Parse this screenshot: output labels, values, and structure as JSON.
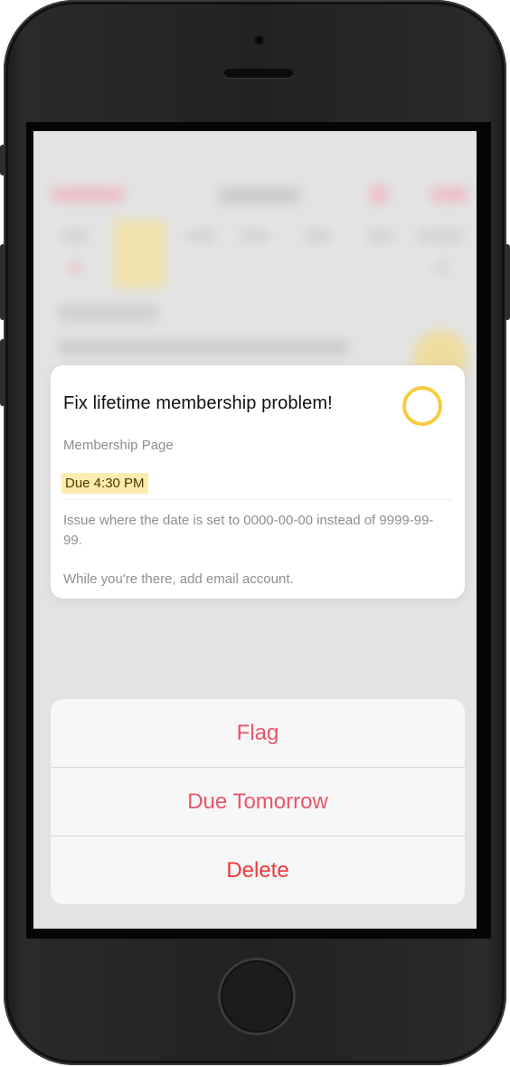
{
  "task_preview": {
    "title": "Fix lifetime membership problem!",
    "list": "Membership Page",
    "due": "Due 4:30 PM",
    "notes": [
      "Issue where the date is set to 0000-00-00 instead of 9999-99-99.",
      "While you're there, add email account."
    ],
    "ring_color": "#f6cc3f",
    "due_highlight_color": "#fcecae"
  },
  "actions": {
    "flag": "Flag",
    "due_tomorrow": "Due Tomorrow",
    "delete": "Delete"
  },
  "colors": {
    "action_tint": "#e8556a",
    "destructive": "#f2363a"
  }
}
